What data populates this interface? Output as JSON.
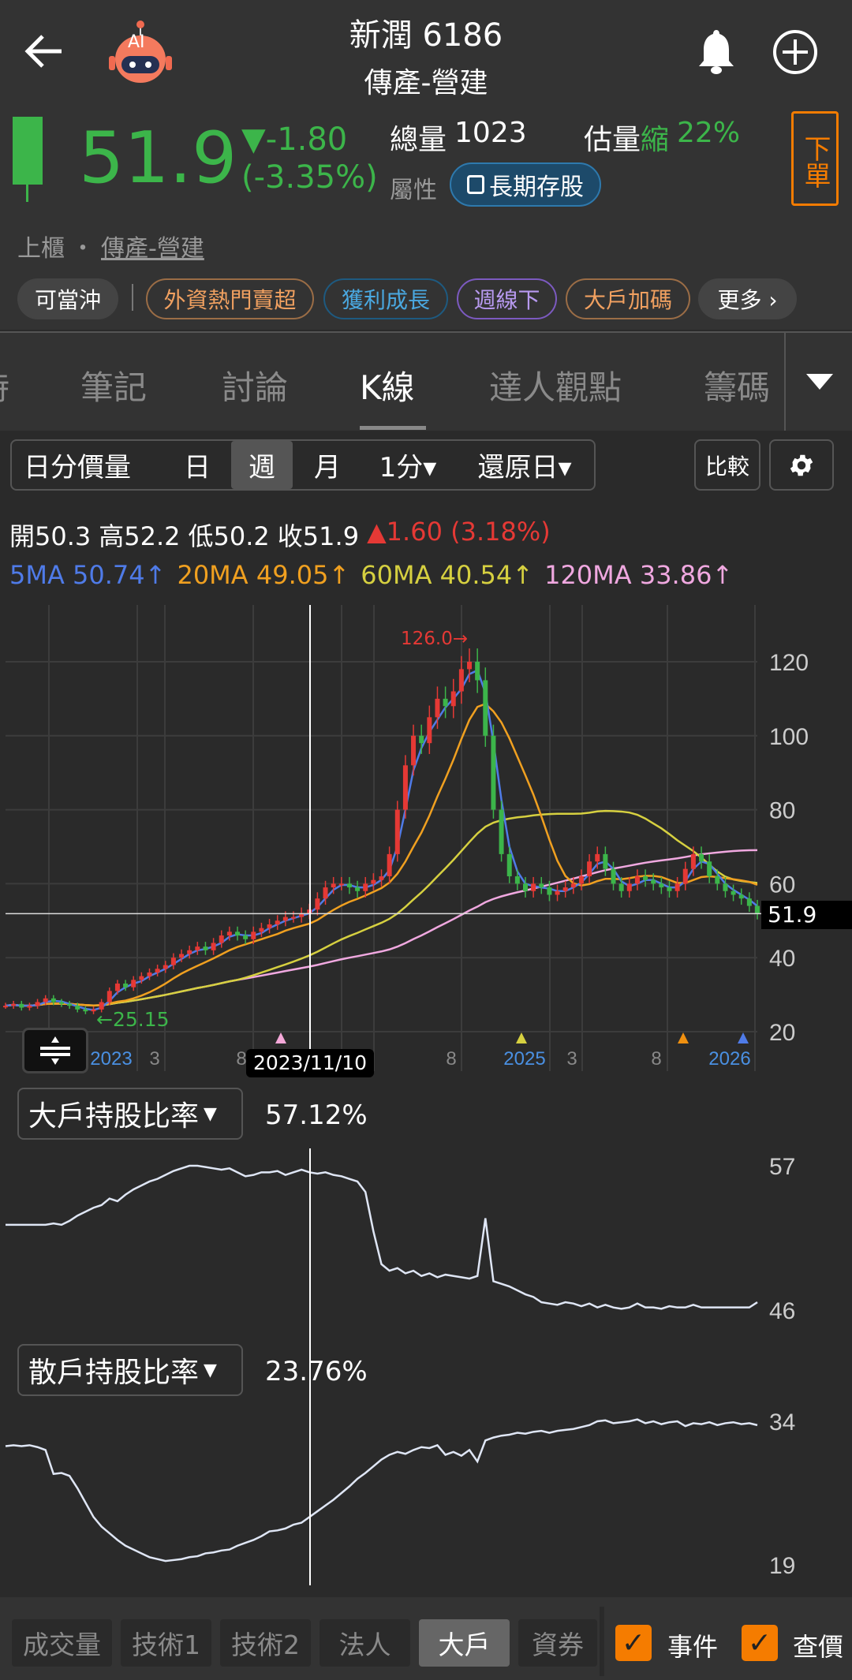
{
  "header": {
    "title": "新潤 6186",
    "subtitle": "傳產-營建",
    "ai_label": "AI"
  },
  "quote": {
    "price": "51.9",
    "change": "▼-1.80",
    "change_pct": "(-3.35%)",
    "volume_label": "總量",
    "volume": "1023",
    "est_label": "估量",
    "est_dir": "縮",
    "est_pct": "22%",
    "attr_label": "屬性",
    "attr_tag": "長期存股",
    "order_button": "下單",
    "market": "上櫃",
    "dot": "・",
    "industry": "傳產-營建",
    "colors": {
      "down": "#3cb54a",
      "up": "#e53935"
    }
  },
  "chips": [
    "可當沖",
    "外資熱門賣超",
    "獲利成長",
    "週線下",
    "大戶加碼",
    "更多 ›"
  ],
  "tabs": [
    "時",
    "筆記",
    "討論",
    "K線",
    "達人觀點",
    "籌碼"
  ],
  "active_tab": "K線",
  "toolbar": {
    "items": [
      "日分價量",
      "日",
      "週",
      "月",
      "1分▾",
      "還原日▾"
    ],
    "active": "週",
    "compare": "比較"
  },
  "ohlc": {
    "open": "開50.3",
    "high": "高52.2",
    "low": "低50.2",
    "close": "收51.9",
    "change": "▲1.60 (3.18%)"
  },
  "ma": {
    "ma5": "5MA 50.74↑",
    "ma20": "20MA 49.05↑",
    "ma60": "60MA 40.54↑",
    "ma120": "120MA 33.86↑",
    "colors": {
      "ma5": "#4f7be8",
      "ma20": "#f0a020",
      "ma60": "#d6d040",
      "ma120": "#f0a8e0"
    }
  },
  "chart_data": [
    {
      "type": "candlestick",
      "title": "週K線",
      "ylim": [
        20,
        130
      ],
      "yticks": [
        "120",
        "100",
        "80",
        "60",
        "40",
        "20"
      ],
      "last_price_label": "51.9",
      "max_label": "126.0→",
      "min_label": "←25.15",
      "crosshair_label": "2023/11/10",
      "xticks": [
        "8",
        "2023",
        "3",
        "8",
        "8",
        "2025",
        "3",
        "8",
        "2026"
      ],
      "closes": [
        27,
        27.5,
        26.5,
        27,
        28,
        29,
        28,
        27.5,
        27,
        26,
        25.5,
        26,
        28,
        31,
        33,
        32,
        34,
        35,
        36,
        37,
        38,
        40,
        41,
        42,
        43,
        42,
        44,
        46,
        47,
        46,
        45,
        47,
        48,
        49,
        50,
        51,
        51,
        52,
        53,
        56,
        59,
        60,
        60,
        59,
        58,
        60,
        61,
        62,
        68,
        80,
        92,
        100,
        98,
        105,
        110,
        108,
        112,
        118,
        120,
        115,
        100,
        80,
        68,
        62,
        60,
        58,
        60,
        59,
        57,
        58,
        59,
        60,
        62,
        66,
        68,
        64,
        60,
        58,
        60,
        62,
        61,
        60,
        59,
        58,
        60,
        64,
        68,
        66,
        62,
        60,
        58,
        57,
        56,
        54,
        51.9
      ]
    },
    {
      "type": "line",
      "title": "大戶持股比率",
      "value": "57.12%",
      "yticks": [
        "57",
        "46"
      ],
      "ylim": [
        46,
        57
      ],
      "values": [
        52.5,
        52.5,
        52.5,
        52.5,
        52.5,
        52.5,
        52.6,
        52.5,
        52.8,
        53.2,
        53.5,
        53.8,
        54,
        54.5,
        54.3,
        54.8,
        55.2,
        55.5,
        55.8,
        56,
        56.3,
        56.6,
        56.8,
        57,
        57,
        56.9,
        56.8,
        56.7,
        56.8,
        56.5,
        56.2,
        56.3,
        56.5,
        56.5,
        56.6,
        56.3,
        56.5,
        56.7,
        56.5,
        56.4,
        56.5,
        56.3,
        56.2,
        56,
        55.8,
        55,
        52,
        49.5,
        49,
        49.2,
        48.8,
        49,
        48.6,
        48.8,
        48.5,
        48.7,
        48.6,
        48.5,
        48.4,
        48.6,
        53,
        48.2,
        48,
        47.8,
        47.5,
        47.2,
        47,
        46.6,
        46.5,
        46.4,
        46.6,
        46.5,
        46.3,
        46.5,
        46.2,
        46.4,
        46.2,
        46.1,
        46.2,
        46.5,
        46.2,
        46.2,
        46.1,
        46.3,
        46.2,
        46.2,
        46.4,
        46.2,
        46.2,
        46.2,
        46.2,
        46.2,
        46.2,
        46.2,
        46.6
      ]
    },
    {
      "type": "line",
      "title": "散戶持股比率",
      "value": "23.76%",
      "yticks": [
        "34",
        "19"
      ],
      "ylim": [
        19,
        34
      ],
      "values": [
        31.4,
        31.5,
        31.4,
        31.5,
        31.3,
        31,
        28.5,
        28.6,
        28.3,
        27,
        25.5,
        24,
        23,
        22.3,
        21.6,
        21,
        20.6,
        20.2,
        19.8,
        19.6,
        19.4,
        19.5,
        19.6,
        19.8,
        19.9,
        20.2,
        20.3,
        20.5,
        20.6,
        21,
        21.3,
        21.6,
        22,
        22.5,
        22.6,
        22.8,
        23.2,
        23.4,
        24,
        24.6,
        25.2,
        25.8,
        26.5,
        27.2,
        28,
        28.6,
        29.3,
        30,
        30.5,
        30.8,
        30.6,
        31,
        31.3,
        31.2,
        31.5,
        30.5,
        30.8,
        30.4,
        31,
        29.8,
        32,
        32.3,
        32.5,
        32.6,
        32.8,
        32.7,
        32.9,
        33,
        32.8,
        33,
        33.1,
        33.2,
        33.4,
        33.6,
        34,
        34.1,
        33.8,
        33.9,
        34,
        34.2,
        33.8,
        34,
        33.7,
        33.9,
        34,
        33.5,
        33.8,
        33.7,
        33.9,
        33.6,
        33.8,
        33.9,
        33.7,
        33.8,
        33.6
      ]
    }
  ],
  "bottom": {
    "tabs": [
      "成交量",
      "技術1",
      "技術2",
      "法人",
      "大戶",
      "資券"
    ],
    "active": "大戶",
    "checks": [
      "事件",
      "查價"
    ]
  }
}
